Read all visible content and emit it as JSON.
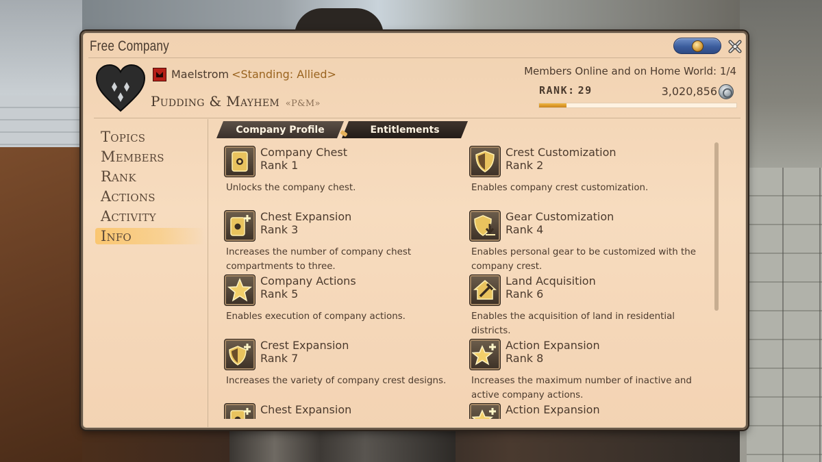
{
  "window": {
    "title": "Free Company"
  },
  "header": {
    "grand_company": "Maelstrom",
    "standing": "<Standing: Allied>",
    "fc_name": "Pudding & Mayhem",
    "fc_tag": "«P&M»",
    "members_online": "Members Online and on Home World: 1/4",
    "rank_label": "RANK:",
    "rank_value": "29",
    "credits": "3,020,856",
    "rank_progress": 0.14
  },
  "nav": {
    "items": [
      {
        "label": "Topics"
      },
      {
        "label": "Members"
      },
      {
        "label": "Rank"
      },
      {
        "label": "Actions"
      },
      {
        "label": "Activity"
      },
      {
        "label": "Info"
      }
    ],
    "active_index": 5
  },
  "tabs": [
    {
      "label": "Company Profile"
    },
    {
      "label": "Entitlements"
    }
  ],
  "entitlements": [
    {
      "name": "Company Chest",
      "rank": "Rank 1",
      "desc": "Unlocks the company chest.",
      "icon": "chest-icon"
    },
    {
      "name": "Crest Customization",
      "rank": "Rank 2",
      "desc": "Enables company crest customization.",
      "icon": "shield-icon"
    },
    {
      "name": "Chest Expansion",
      "rank": "Rank 3",
      "desc": "Increases the number of company chest compartments to three.",
      "icon": "chest-plus-icon"
    },
    {
      "name": "Gear Customization",
      "rank": "Rank 4",
      "desc": "Enables personal gear to be customized with the company crest.",
      "icon": "shield-arrow-icon"
    },
    {
      "name": "Company Actions",
      "rank": "Rank 5",
      "desc": "Enables execution of company actions.",
      "icon": "star-icon"
    },
    {
      "name": "Land Acquisition",
      "rank": "Rank 6",
      "desc": "Enables the acquisition of land in residential districts.",
      "icon": "house-hammer-icon"
    },
    {
      "name": "Crest Expansion",
      "rank": "Rank 7",
      "desc": "Increases the variety of company crest designs.",
      "icon": "shield-plus-icon"
    },
    {
      "name": "Action Expansion",
      "rank": "Rank 8",
      "desc": "Increases the maximum number of inactive and active company actions.",
      "icon": "star-plus-icon"
    },
    {
      "name": "Chest Expansion",
      "rank": "",
      "desc": "",
      "icon": "chest-plus-icon"
    },
    {
      "name": "Action Expansion",
      "rank": "",
      "desc": "",
      "icon": "star-plus-icon"
    }
  ]
}
